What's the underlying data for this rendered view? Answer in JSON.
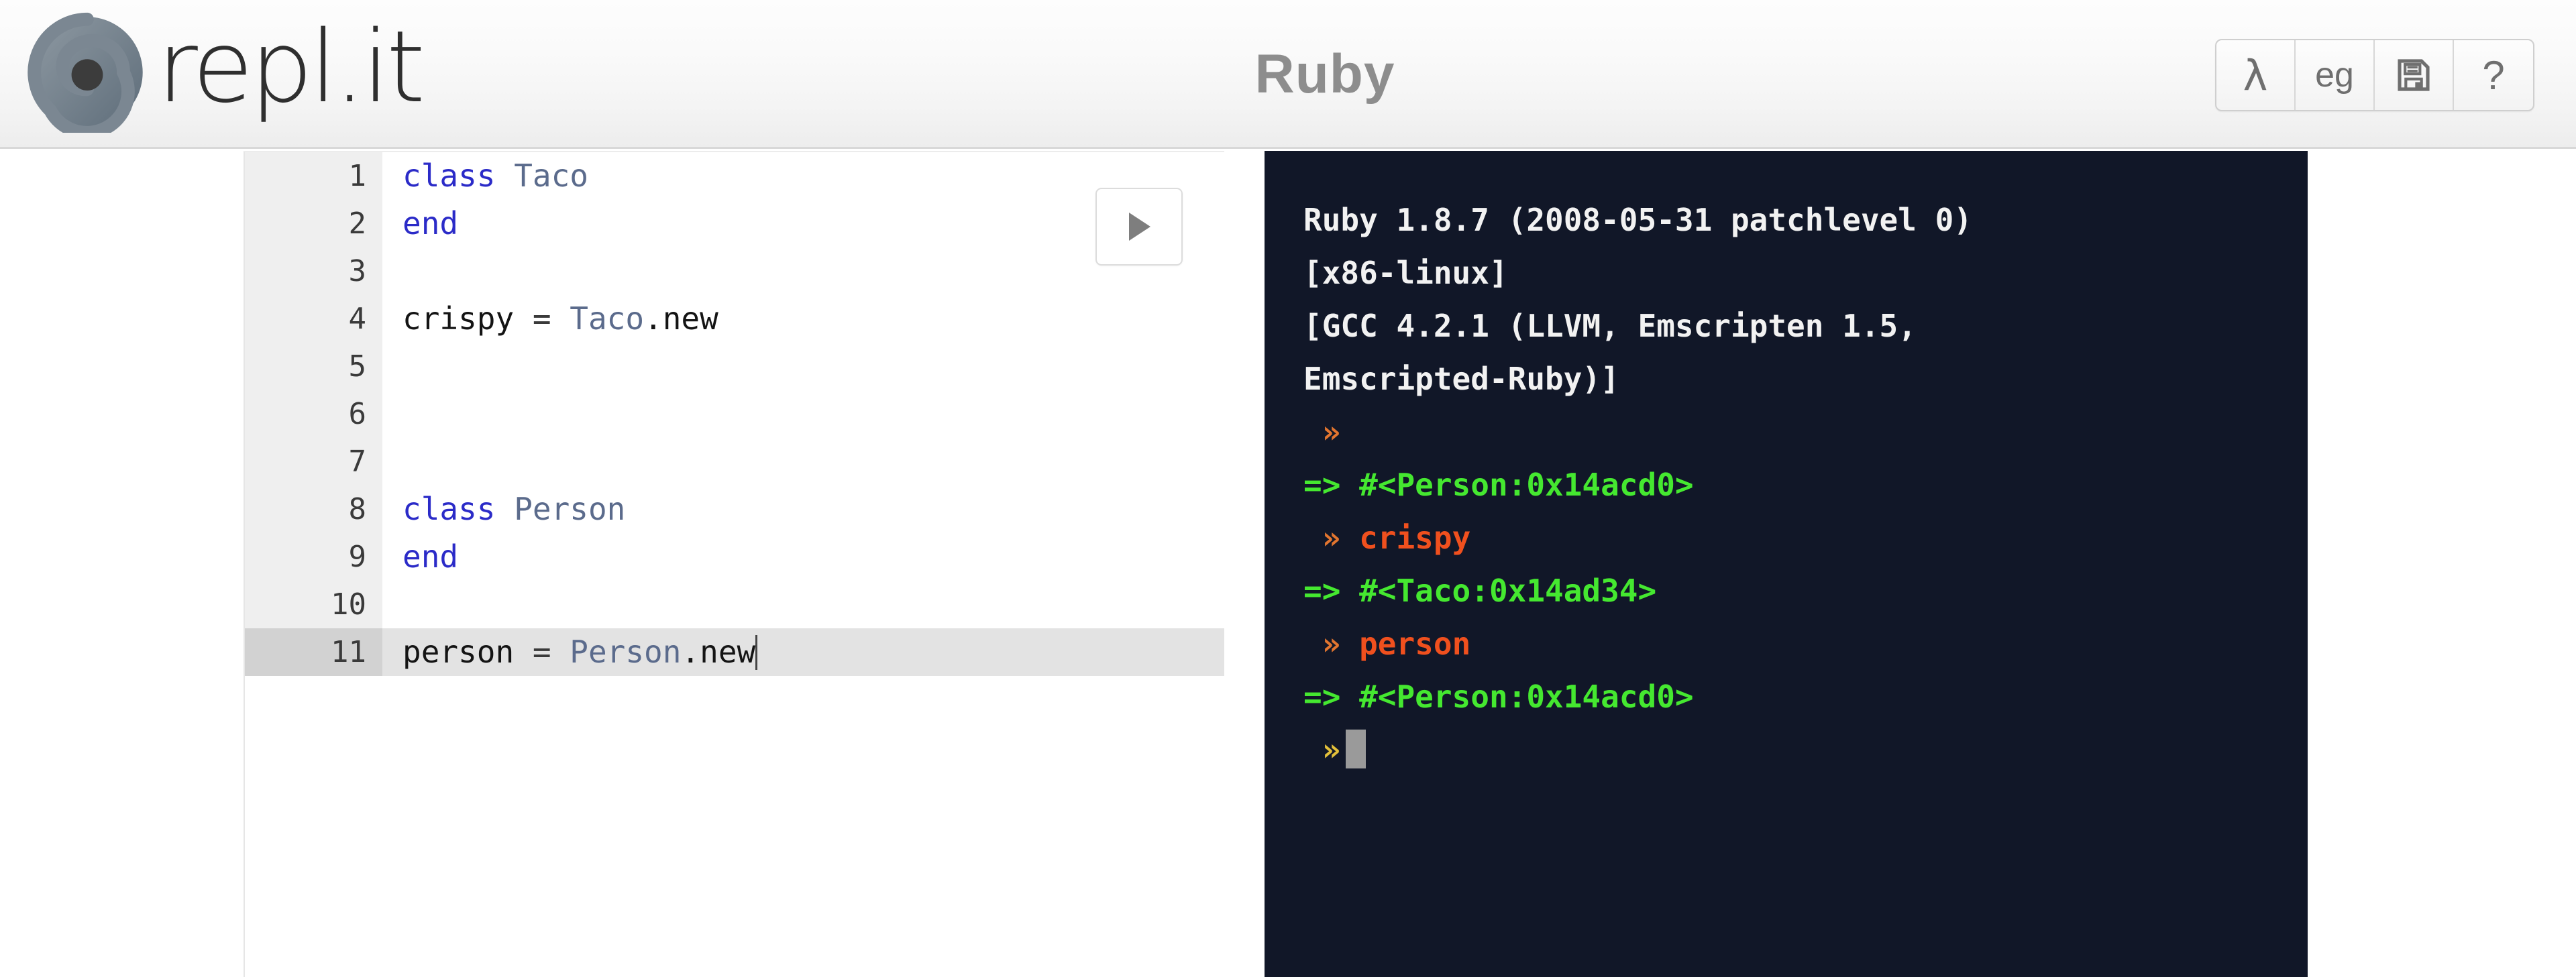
{
  "header": {
    "brand_wordmark": "repl.it",
    "logo_icon": "repl-spiral-logo-icon",
    "title": "Ruby",
    "toolbar": [
      {
        "label": "λ",
        "name": "lambda-button",
        "kind": "text"
      },
      {
        "label": "eg",
        "name": "examples-button",
        "kind": "text"
      },
      {
        "label": "",
        "name": "save-button",
        "kind": "floppy-disk-icon"
      },
      {
        "label": "?",
        "name": "help-button",
        "kind": "text"
      }
    ]
  },
  "editor": {
    "run_button_label": "play-icon",
    "lines": [
      {
        "num": "1",
        "active": false,
        "tokens": [
          {
            "t": "class",
            "c": "tok-kw"
          },
          {
            "t": " ",
            "c": "tok-op"
          },
          {
            "t": "Taco",
            "c": "tok-cls"
          }
        ]
      },
      {
        "num": "2",
        "active": false,
        "tokens": [
          {
            "t": "end",
            "c": "tok-kw"
          }
        ]
      },
      {
        "num": "3",
        "active": false,
        "tokens": []
      },
      {
        "num": "4",
        "active": false,
        "tokens": [
          {
            "t": "crispy",
            "c": "tok-id"
          },
          {
            "t": " = ",
            "c": "tok-op"
          },
          {
            "t": "Taco",
            "c": "tok-cls"
          },
          {
            "t": ".new",
            "c": "tok-id"
          }
        ]
      },
      {
        "num": "5",
        "active": false,
        "tokens": []
      },
      {
        "num": "6",
        "active": false,
        "tokens": []
      },
      {
        "num": "7",
        "active": false,
        "tokens": []
      },
      {
        "num": "8",
        "active": false,
        "tokens": [
          {
            "t": "class",
            "c": "tok-kw"
          },
          {
            "t": " ",
            "c": "tok-op"
          },
          {
            "t": "Person",
            "c": "tok-cls"
          }
        ]
      },
      {
        "num": "9",
        "active": false,
        "tokens": [
          {
            "t": "end",
            "c": "tok-kw"
          }
        ]
      },
      {
        "num": "10",
        "active": false,
        "tokens": []
      },
      {
        "num": "11",
        "active": true,
        "caret": true,
        "tokens": [
          {
            "t": "person",
            "c": "tok-id"
          },
          {
            "t": " = ",
            "c": "tok-op"
          },
          {
            "t": "Person",
            "c": "tok-cls"
          },
          {
            "t": ".new",
            "c": "tok-id"
          }
        ]
      }
    ]
  },
  "console": {
    "lines": [
      {
        "segments": [
          {
            "t": "Ruby 1.8.7 (2008-05-31 patchlevel 0)",
            "c": "c-banner"
          }
        ]
      },
      {
        "segments": [
          {
            "t": "[x86-linux]",
            "c": "c-banner"
          }
        ]
      },
      {
        "segments": [
          {
            "t": "[GCC 4.2.1 (LLVM, Emscripten 1.5,",
            "c": "c-banner"
          }
        ]
      },
      {
        "segments": [
          {
            "t": "Emscripted-Ruby)]",
            "c": "c-banner"
          }
        ]
      },
      {
        "segments": [
          {
            "t": " »",
            "c": "c-prompt"
          }
        ]
      },
      {
        "segments": [
          {
            "t": "=> #<Person:0x14acd0>",
            "c": "c-result"
          }
        ]
      },
      {
        "segments": [
          {
            "t": " » ",
            "c": "c-prompt"
          },
          {
            "t": "crispy",
            "c": "c-input"
          }
        ]
      },
      {
        "segments": [
          {
            "t": "=> #<Taco:0x14ad34>",
            "c": "c-result"
          }
        ]
      },
      {
        "segments": [
          {
            "t": " » ",
            "c": "c-prompt"
          },
          {
            "t": "person",
            "c": "c-input"
          }
        ]
      },
      {
        "segments": [
          {
            "t": "=> #<Person:0x14acd0>",
            "c": "c-result"
          }
        ]
      },
      {
        "segments": [
          {
            "t": " »",
            "c": "c-prompt-cur"
          }
        ],
        "cursor": true
      }
    ]
  },
  "colors": {
    "console_background": "#111728",
    "console_result": "#45e830",
    "console_input": "#f0501e",
    "console_prompt": "#e2752f",
    "keyword": "#2b2bc8",
    "class_name": "#5b6b8c",
    "header_title": "#8d8d8d"
  }
}
